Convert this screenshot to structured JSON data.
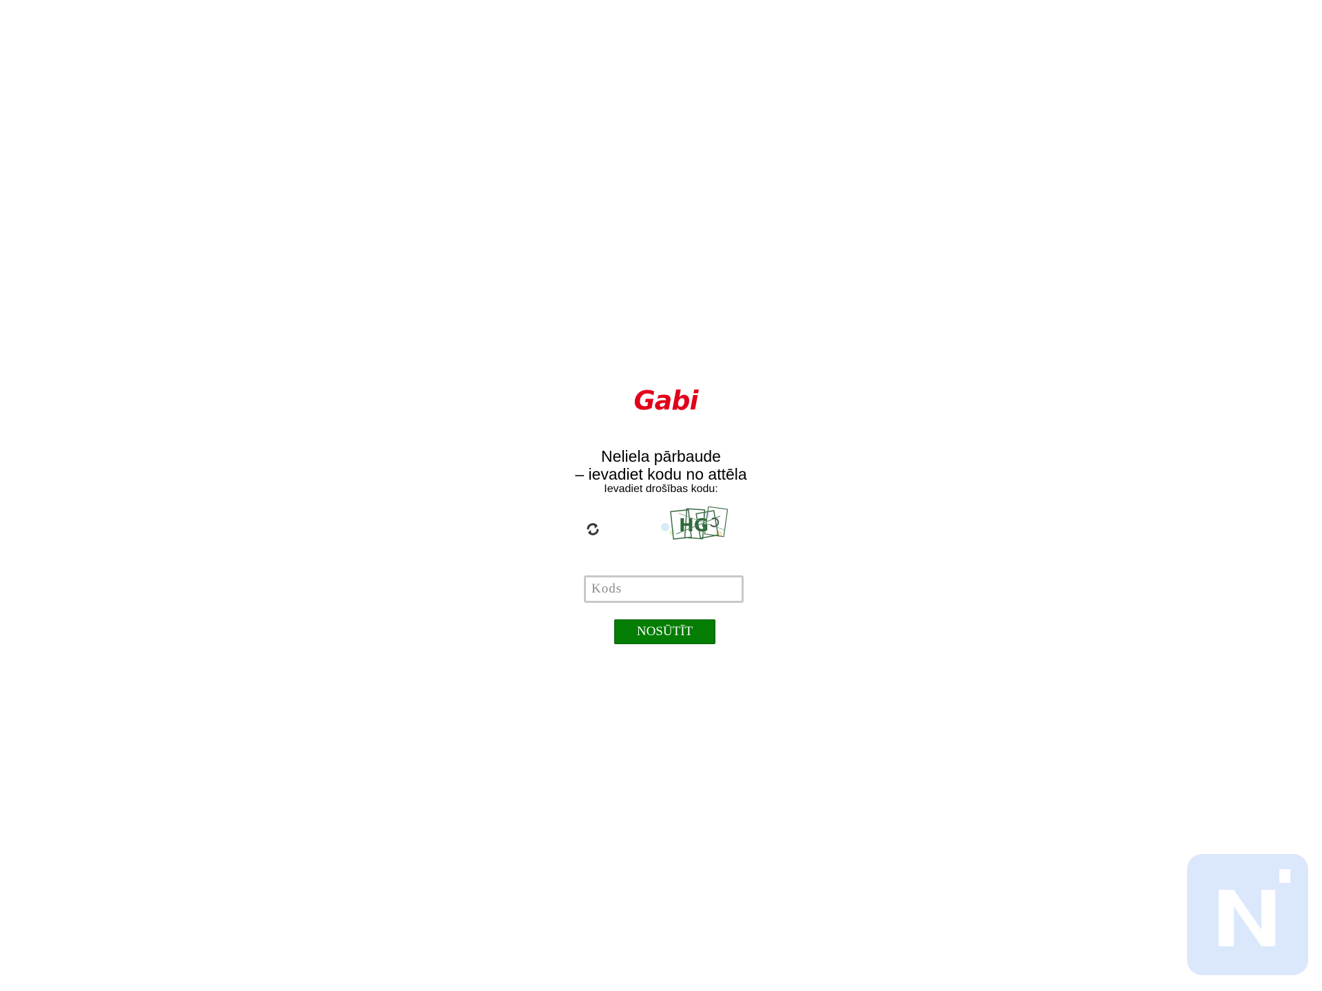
{
  "logo": {
    "text": "Gabi",
    "color": "#e2001a"
  },
  "heading": {
    "line1": "Neliela pārbaude",
    "line2": "– ievadiet kodu no attēla"
  },
  "prompt": "Ievadiet drošības kodu:",
  "captcha": {
    "refresh_icon": "refresh-icon",
    "image_text": "HG"
  },
  "code_field": {
    "value": "",
    "placeholder": "Kods"
  },
  "submit": {
    "label": "NOSŪTĪT",
    "color": "#037d03"
  },
  "badge": {
    "icon": "n-logo-icon",
    "color": "#dbe8fc"
  }
}
